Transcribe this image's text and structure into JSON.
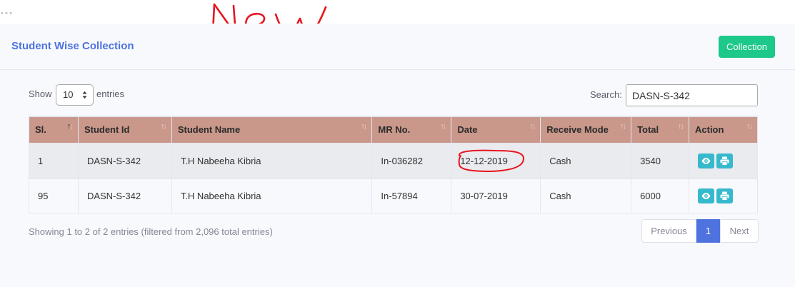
{
  "annotation": {
    "text": "New",
    "color": "#e8141c"
  },
  "card": {
    "title": "Student Wise Collection",
    "collection_button": "Collection",
    "accent": "#4e73df",
    "button_color": "#1cc88a"
  },
  "length": {
    "show": "Show",
    "value": "10",
    "entries": "entries"
  },
  "search": {
    "label": "Search:",
    "value": "DASN-S-342"
  },
  "table": {
    "header_color": "#c9988a",
    "columns": [
      "Sl.",
      "Student Id",
      "Student Name",
      "MR No.",
      "Date",
      "Receive Mode",
      "Total",
      "Action"
    ],
    "rows": [
      {
        "sl": "1",
        "student_id": "DASN-S-342",
        "name": "T.H Nabeeha Kibria",
        "mr_no": "In-036282",
        "date": "12-12-2019",
        "mode": "Cash",
        "total": "3540",
        "actions": [
          "eye-icon",
          "print-icon"
        ]
      },
      {
        "sl": "95",
        "student_id": "DASN-S-342",
        "name": "T.H Nabeeha Kibria",
        "mr_no": "In-57894",
        "date": "30-07-2019",
        "mode": "Cash",
        "total": "6000",
        "actions": [
          "eye-icon",
          "print-icon"
        ]
      }
    ]
  },
  "footer": {
    "info": "Showing 1 to 2 of 2 entries (filtered from 2,096 total entries)"
  },
  "pagination": {
    "previous": "Previous",
    "current": "1",
    "next": "Next"
  }
}
